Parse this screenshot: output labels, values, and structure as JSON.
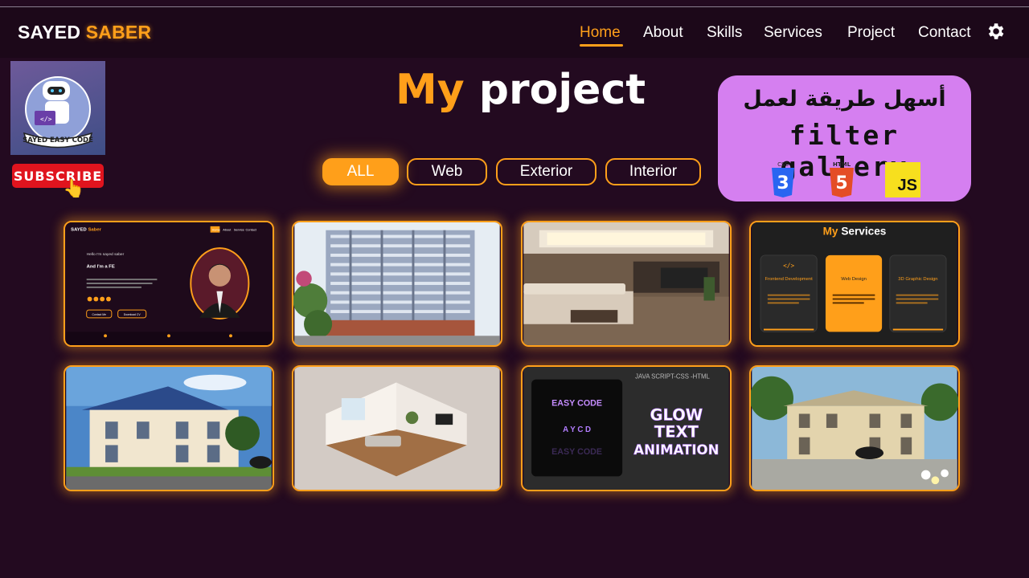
{
  "brand": {
    "first": "SAYED",
    "last": "SABER"
  },
  "nav": {
    "items": [
      "Home",
      "About",
      "Skills",
      "Services",
      "Project",
      "Contact"
    ],
    "active": "Home"
  },
  "channel": {
    "logo_text": "SAYED EASY CODE",
    "subscribe_label": "SUBSCRIBE"
  },
  "page": {
    "title_first": "My",
    "title_rest": "project"
  },
  "filters": [
    "ALL",
    "Web",
    "Exterior",
    "Interior"
  ],
  "promo": {
    "arabic_text": "أسهل طريقة لعمل",
    "headline": "filter gallery",
    "badges": [
      "CSS",
      "HTML",
      "JS"
    ]
  },
  "gallery": {
    "portfolio_card": {
      "brand_first": "SAYED",
      "brand_last": "Saber",
      "nav": [
        "Home",
        "About",
        "Service",
        "Contact"
      ],
      "hello": "Hello I'm sayed saber",
      "role": "And I'm a FE",
      "contact_btn": "Contact Me",
      "download_btn": "Download CV"
    },
    "services_card": {
      "title_first": "My",
      "title_rest": "Services",
      "items": [
        "Frontend Development",
        "Web Design",
        "3D Graphic Design"
      ]
    },
    "glow_card": {
      "caption": "JAVA SCRIPT-CSS -HTML",
      "lines": [
        "EASY CODE",
        "A Y C D",
        "EASY CODE"
      ],
      "headline": [
        "GLOW",
        "TEXT",
        "ANIMATION"
      ]
    }
  },
  "colors": {
    "accent": "#ff9f1a",
    "background": "#230a20",
    "navbar": "#1c0819",
    "promo": "#d57ff0",
    "subscribe": "#e0141e"
  }
}
